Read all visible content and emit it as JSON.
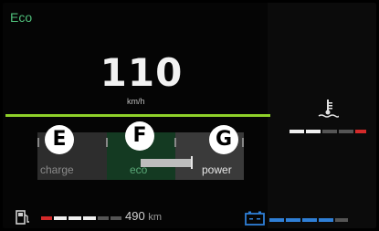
{
  "header": {
    "mode": "Eco"
  },
  "speedometer": {
    "speed": "110",
    "unit": "km/h"
  },
  "power_gauge": {
    "zones": [
      {
        "badge": "E",
        "label": "charge"
      },
      {
        "badge": "F",
        "label": "eco"
      },
      {
        "badge": "G",
        "label": "power"
      }
    ],
    "eco_level_fraction": 0.75
  },
  "coolant": {
    "icon": "coolant-temperature-icon",
    "segments_filled": 2,
    "segments_total": 5,
    "warning_color": "#d42a2a"
  },
  "fuel": {
    "icon": "fuel-pump-icon",
    "range_value": "490",
    "range_unit": "km",
    "segments_filled": 3,
    "segments_total": 6,
    "warning_color": "#d42a2a"
  },
  "battery": {
    "icon": "battery-icon",
    "segments_filled": 4,
    "segments_total": 5,
    "accent_color": "#2f7fd6"
  },
  "colors": {
    "accent_green": "#8fd12a",
    "mode_text": "#4fbf7a"
  }
}
